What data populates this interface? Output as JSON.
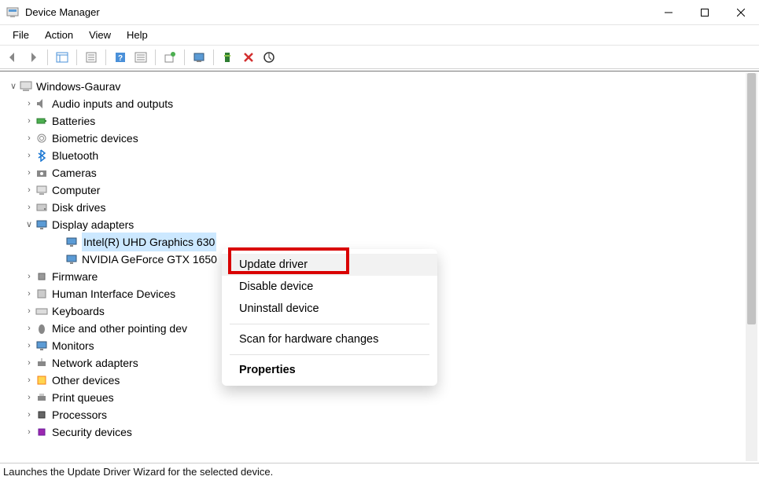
{
  "window": {
    "title": "Device Manager"
  },
  "menubar": {
    "file": "File",
    "action": "Action",
    "view": "View",
    "help": "Help"
  },
  "tree": {
    "root": "Windows-Gaurav",
    "items": {
      "audio": "Audio inputs and outputs",
      "batteries": "Batteries",
      "biometric": "Biometric devices",
      "bluetooth": "Bluetooth",
      "cameras": "Cameras",
      "computer": "Computer",
      "disk": "Disk drives",
      "display": "Display adapters",
      "display_children": {
        "intel": "Intel(R) UHD Graphics 630",
        "nvidia": "NVIDIA GeForce GTX 1650"
      },
      "firmware": "Firmware",
      "hid": "Human Interface Devices",
      "keyboards": "Keyboards",
      "mice": "Mice and other pointing dev",
      "monitors": "Monitors",
      "network": "Network adapters",
      "other": "Other devices",
      "print": "Print queues",
      "processors": "Processors",
      "security": "Security devices"
    }
  },
  "context_menu": {
    "update": "Update driver",
    "disable": "Disable device",
    "uninstall": "Uninstall device",
    "scan": "Scan for hardware changes",
    "properties": "Properties"
  },
  "statusbar": {
    "text": "Launches the Update Driver Wizard for the selected device."
  }
}
